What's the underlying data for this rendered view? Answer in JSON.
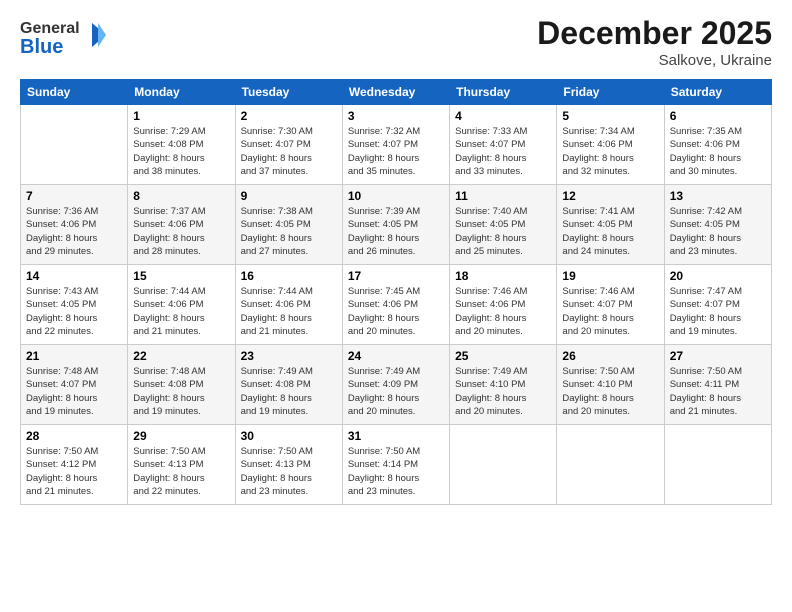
{
  "header": {
    "logo_general": "General",
    "logo_blue": "Blue",
    "month": "December 2025",
    "location": "Salkove, Ukraine"
  },
  "weekdays": [
    "Sunday",
    "Monday",
    "Tuesday",
    "Wednesday",
    "Thursday",
    "Friday",
    "Saturday"
  ],
  "weeks": [
    [
      {
        "day": "",
        "info": ""
      },
      {
        "day": "1",
        "info": "Sunrise: 7:29 AM\nSunset: 4:08 PM\nDaylight: 8 hours\nand 38 minutes."
      },
      {
        "day": "2",
        "info": "Sunrise: 7:30 AM\nSunset: 4:07 PM\nDaylight: 8 hours\nand 37 minutes."
      },
      {
        "day": "3",
        "info": "Sunrise: 7:32 AM\nSunset: 4:07 PM\nDaylight: 8 hours\nand 35 minutes."
      },
      {
        "day": "4",
        "info": "Sunrise: 7:33 AM\nSunset: 4:07 PM\nDaylight: 8 hours\nand 33 minutes."
      },
      {
        "day": "5",
        "info": "Sunrise: 7:34 AM\nSunset: 4:06 PM\nDaylight: 8 hours\nand 32 minutes."
      },
      {
        "day": "6",
        "info": "Sunrise: 7:35 AM\nSunset: 4:06 PM\nDaylight: 8 hours\nand 30 minutes."
      }
    ],
    [
      {
        "day": "7",
        "info": "Sunrise: 7:36 AM\nSunset: 4:06 PM\nDaylight: 8 hours\nand 29 minutes."
      },
      {
        "day": "8",
        "info": "Sunrise: 7:37 AM\nSunset: 4:06 PM\nDaylight: 8 hours\nand 28 minutes."
      },
      {
        "day": "9",
        "info": "Sunrise: 7:38 AM\nSunset: 4:05 PM\nDaylight: 8 hours\nand 27 minutes."
      },
      {
        "day": "10",
        "info": "Sunrise: 7:39 AM\nSunset: 4:05 PM\nDaylight: 8 hours\nand 26 minutes."
      },
      {
        "day": "11",
        "info": "Sunrise: 7:40 AM\nSunset: 4:05 PM\nDaylight: 8 hours\nand 25 minutes."
      },
      {
        "day": "12",
        "info": "Sunrise: 7:41 AM\nSunset: 4:05 PM\nDaylight: 8 hours\nand 24 minutes."
      },
      {
        "day": "13",
        "info": "Sunrise: 7:42 AM\nSunset: 4:05 PM\nDaylight: 8 hours\nand 23 minutes."
      }
    ],
    [
      {
        "day": "14",
        "info": "Sunrise: 7:43 AM\nSunset: 4:05 PM\nDaylight: 8 hours\nand 22 minutes."
      },
      {
        "day": "15",
        "info": "Sunrise: 7:44 AM\nSunset: 4:06 PM\nDaylight: 8 hours\nand 21 minutes."
      },
      {
        "day": "16",
        "info": "Sunrise: 7:44 AM\nSunset: 4:06 PM\nDaylight: 8 hours\nand 21 minutes."
      },
      {
        "day": "17",
        "info": "Sunrise: 7:45 AM\nSunset: 4:06 PM\nDaylight: 8 hours\nand 20 minutes."
      },
      {
        "day": "18",
        "info": "Sunrise: 7:46 AM\nSunset: 4:06 PM\nDaylight: 8 hours\nand 20 minutes."
      },
      {
        "day": "19",
        "info": "Sunrise: 7:46 AM\nSunset: 4:07 PM\nDaylight: 8 hours\nand 20 minutes."
      },
      {
        "day": "20",
        "info": "Sunrise: 7:47 AM\nSunset: 4:07 PM\nDaylight: 8 hours\nand 19 minutes."
      }
    ],
    [
      {
        "day": "21",
        "info": "Sunrise: 7:48 AM\nSunset: 4:07 PM\nDaylight: 8 hours\nand 19 minutes."
      },
      {
        "day": "22",
        "info": "Sunrise: 7:48 AM\nSunset: 4:08 PM\nDaylight: 8 hours\nand 19 minutes."
      },
      {
        "day": "23",
        "info": "Sunrise: 7:49 AM\nSunset: 4:08 PM\nDaylight: 8 hours\nand 19 minutes."
      },
      {
        "day": "24",
        "info": "Sunrise: 7:49 AM\nSunset: 4:09 PM\nDaylight: 8 hours\nand 20 minutes."
      },
      {
        "day": "25",
        "info": "Sunrise: 7:49 AM\nSunset: 4:10 PM\nDaylight: 8 hours\nand 20 minutes."
      },
      {
        "day": "26",
        "info": "Sunrise: 7:50 AM\nSunset: 4:10 PM\nDaylight: 8 hours\nand 20 minutes."
      },
      {
        "day": "27",
        "info": "Sunrise: 7:50 AM\nSunset: 4:11 PM\nDaylight: 8 hours\nand 21 minutes."
      }
    ],
    [
      {
        "day": "28",
        "info": "Sunrise: 7:50 AM\nSunset: 4:12 PM\nDaylight: 8 hours\nand 21 minutes."
      },
      {
        "day": "29",
        "info": "Sunrise: 7:50 AM\nSunset: 4:13 PM\nDaylight: 8 hours\nand 22 minutes."
      },
      {
        "day": "30",
        "info": "Sunrise: 7:50 AM\nSunset: 4:13 PM\nDaylight: 8 hours\nand 23 minutes."
      },
      {
        "day": "31",
        "info": "Sunrise: 7:50 AM\nSunset: 4:14 PM\nDaylight: 8 hours\nand 23 minutes."
      },
      {
        "day": "",
        "info": ""
      },
      {
        "day": "",
        "info": ""
      },
      {
        "day": "",
        "info": ""
      }
    ]
  ]
}
